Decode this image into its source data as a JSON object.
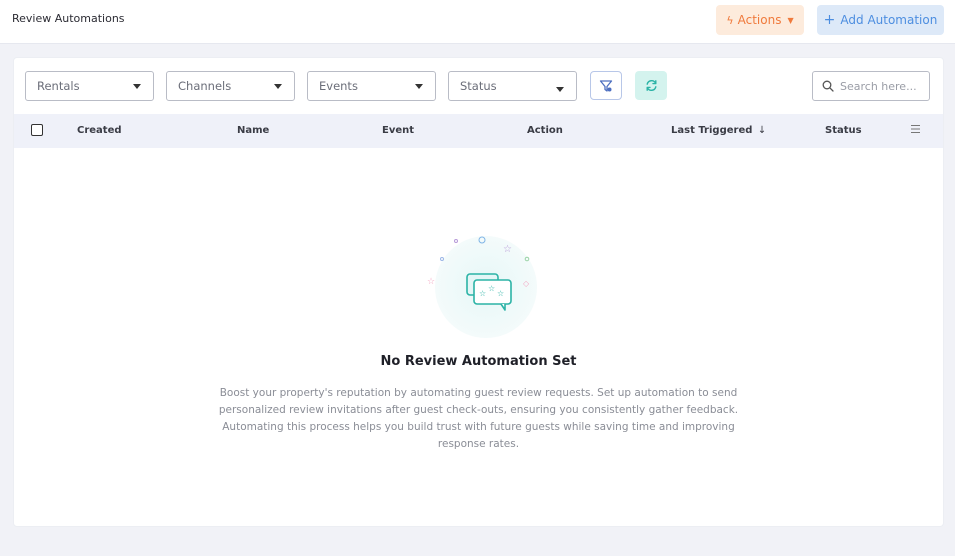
{
  "header": {
    "title": "Review Automations",
    "actions_label": "Actions",
    "add_label": "Add Automation"
  },
  "filters": {
    "rentals": "Rentals",
    "channels": "Channels",
    "events": "Events",
    "status": "Status",
    "search_placeholder": "Search here..."
  },
  "table": {
    "columns": {
      "created": "Created",
      "name": "Name",
      "event": "Event",
      "action": "Action",
      "last_triggered": "Last Triggered",
      "status": "Status"
    }
  },
  "empty": {
    "title": "No Review Automation Set",
    "description": "Boost your property's reputation by automating guest review requests. Set up automation to send personalized review invitations after guest check-outs, ensuring you consistently gather feedback. Automating this process helps you build trust with future guests while saving time and improving response rates."
  },
  "icons": {
    "actions": "bolt-icon",
    "add": "plus-icon",
    "filter": "filter-icon",
    "refresh": "refresh-icon",
    "search": "search-icon",
    "sort": "arrow-down-icon",
    "columns": "menu-icon",
    "illustration": "review-chat-icon"
  },
  "colors": {
    "actions_bg": "#fdebdc",
    "actions_fg": "#f07a3c",
    "add_bg": "#dde9f8",
    "add_fg": "#4d8ee0",
    "refresh_bg": "#d4f3ee",
    "accent_teal": "#2bb3a6"
  }
}
